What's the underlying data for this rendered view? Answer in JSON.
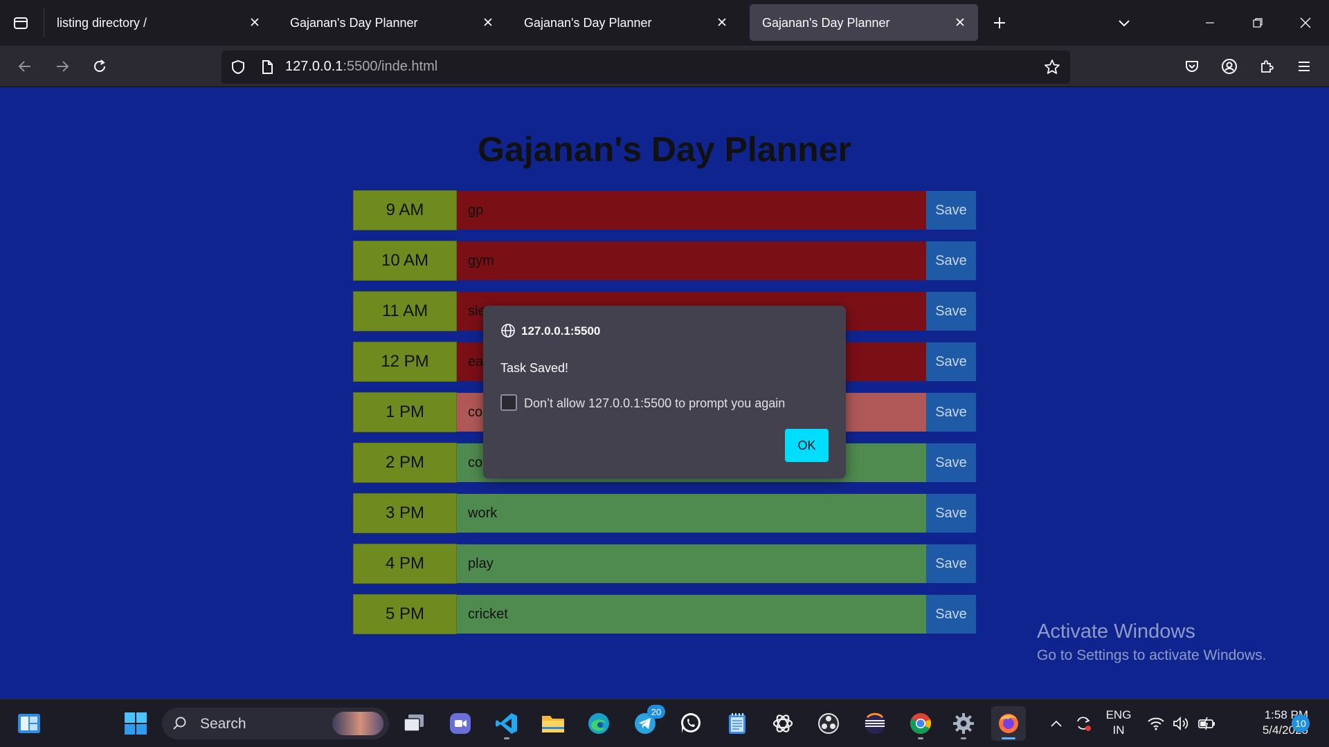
{
  "browser": {
    "tabs": [
      {
        "title": "listing directory /",
        "active": false
      },
      {
        "title": "Gajanan's Day Planner",
        "active": false
      },
      {
        "title": "Gajanan's Day Planner",
        "active": false
      },
      {
        "title": "Gajanan's Day Planner",
        "active": true
      }
    ],
    "url_host": "127.0.0.1",
    "url_rest": ":5500/inde.html"
  },
  "planner": {
    "title": "Gajanan's Day Planner",
    "save_label": "Save",
    "rows": [
      {
        "hour": "9 AM",
        "task": "gp",
        "state": "past"
      },
      {
        "hour": "10 AM",
        "task": "gym",
        "state": "past"
      },
      {
        "hour": "11 AM",
        "task": "sle",
        "state": "past"
      },
      {
        "hour": "12 PM",
        "task": "ea",
        "state": "past"
      },
      {
        "hour": "1 PM",
        "task": "co",
        "state": "present"
      },
      {
        "hour": "2 PM",
        "task": "col",
        "state": "future"
      },
      {
        "hour": "3 PM",
        "task": "work",
        "state": "future"
      },
      {
        "hour": "4 PM",
        "task": "play",
        "state": "future"
      },
      {
        "hour": "5 PM",
        "task": "cricket",
        "state": "future"
      }
    ],
    "colors": {
      "past": "#7b0f16",
      "present": "#b05858",
      "future": "#4f8a4f",
      "hour_bg": "#6f8a1e",
      "save_bg": "#1f5aa6",
      "page_bg": "#10248f"
    }
  },
  "dialog": {
    "origin": "127.0.0.1:5500",
    "message": "Task Saved!",
    "checkbox_label": "Don’t allow 127.0.0.1:5500 to prompt you again",
    "checkbox_checked": false,
    "ok_label": "OK"
  },
  "watermark": {
    "line1": "Activate Windows",
    "line2": "Go to Settings to activate Windows."
  },
  "taskbar": {
    "search_label": "Search",
    "telegram_badge": "20",
    "language_line1": "ENG",
    "language_line2": "IN",
    "time": "1:58 PM",
    "date": "5/4/2025",
    "notification_count": "10"
  }
}
